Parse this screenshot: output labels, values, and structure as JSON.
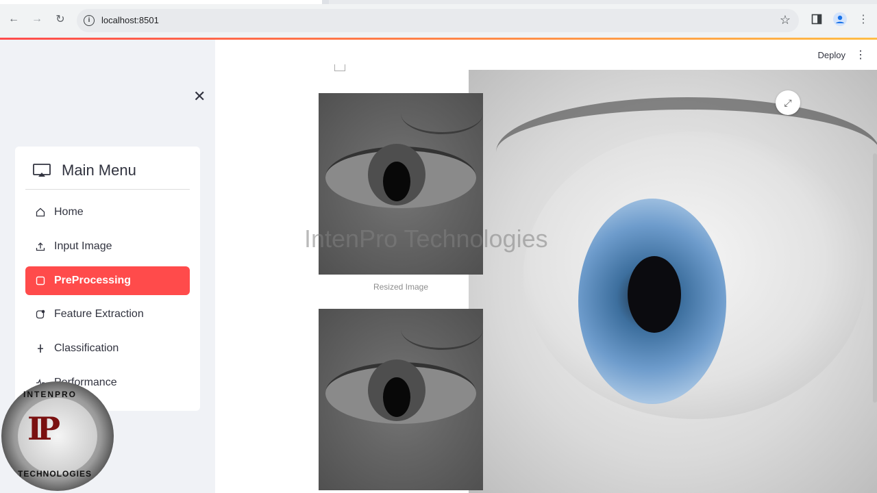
{
  "browser": {
    "url": "localhost:8501",
    "back_icon": "arrow-left",
    "forward_icon": "arrow-right",
    "reload_icon": "reload",
    "site_info_icon": "info",
    "bookmark_icon": "star",
    "side_panel_icon": "side-panel",
    "profile_icon": "person",
    "menu_icon": "kebab"
  },
  "header": {
    "deploy_label": "Deploy"
  },
  "sidebar": {
    "menu_title": "Main Menu",
    "items": [
      {
        "label": "Home",
        "icon": "house"
      },
      {
        "label": "Input Image",
        "icon": "upload"
      },
      {
        "label": "PreProcessing",
        "icon": "square",
        "active": true
      },
      {
        "label": "Feature Extraction",
        "icon": "badge"
      },
      {
        "label": "Classification",
        "icon": "plus-minus"
      },
      {
        "label": "Performance",
        "icon": "activity"
      }
    ]
  },
  "main": {
    "caption": "Resized Image",
    "watermark": "IntenPro Technologies"
  },
  "logo": {
    "ring_top": "INTENPRO",
    "letters": "IP",
    "ring_bottom": "TECHNOLOGIES"
  },
  "colors": {
    "accent": "#ff4b4b",
    "sidebar_bg": "#f0f2f6"
  }
}
